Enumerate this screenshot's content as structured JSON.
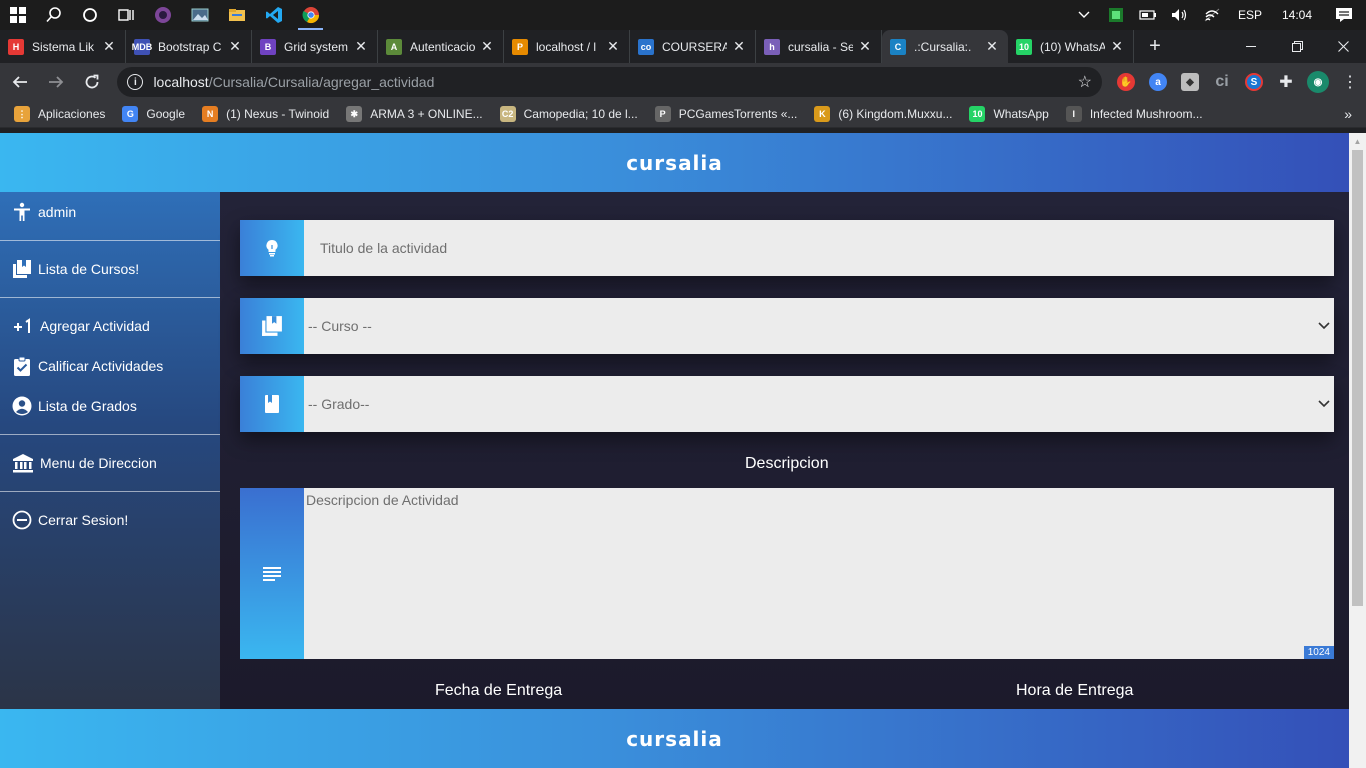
{
  "taskbar": {
    "language": "ESP",
    "time": "14:04",
    "apps": [
      "windows-start",
      "search",
      "cortana",
      "task-view",
      "tor-browser",
      "photos",
      "file-explorer",
      "vscode",
      "chrome"
    ]
  },
  "tabs": [
    {
      "title": "Sistema Lik",
      "color": "#e53935",
      "glyph": "H"
    },
    {
      "title": "Bootstrap C",
      "color": "#3f51b5",
      "glyph": "MDB"
    },
    {
      "title": "Grid system",
      "color": "#6f42c1",
      "glyph": "B"
    },
    {
      "title": "Autenticacio",
      "color": "#5c8a3a",
      "glyph": "A"
    },
    {
      "title": "localhost / l",
      "color": "#e68a00",
      "glyph": "P"
    },
    {
      "title": "COURSERA",
      "color": "#2a73cc",
      "glyph": "co"
    },
    {
      "title": "cursalia - Se",
      "color": "#7a5fb8",
      "glyph": "h"
    },
    {
      "title": ".:Cursalia:.",
      "color": "#1a82c4",
      "glyph": "C"
    },
    {
      "title": "(10) WhatsA",
      "color": "#25d366",
      "glyph": "10"
    }
  ],
  "address": {
    "host": "localhost",
    "path": "/Cursalia/Cursalia/agregar_actividad"
  },
  "bookmarks": [
    {
      "label": "Aplicaciones",
      "color": "#e8a33b",
      "glyph": "⋮"
    },
    {
      "label": "Google",
      "color": "#4285f4",
      "glyph": "G"
    },
    {
      "label": "(1) Nexus - Twinoid",
      "color": "#e67e22",
      "glyph": "N"
    },
    {
      "label": "ARMA 3 + ONLINE...",
      "color": "#777777",
      "glyph": "✱"
    },
    {
      "label": "Camopedia; 10 de l...",
      "color": "#c8b680",
      "glyph": "C2"
    },
    {
      "label": "PCGamesTorrents «...",
      "color": "#666666",
      "glyph": "P"
    },
    {
      "label": "(6) Kingdom.Muxxu...",
      "color": "#d99a1b",
      "glyph": "K"
    },
    {
      "label": "WhatsApp",
      "color": "#25d366",
      "glyph": "10"
    },
    {
      "label": "Infected Mushroom...",
      "color": "#555555",
      "glyph": "I"
    }
  ],
  "site": {
    "logo": "cursalia"
  },
  "sidebar": {
    "user": "admin",
    "courses": "Lista de Cursos!",
    "add_activity": "Agregar Actividad",
    "grade_activities": "Calificar Actividades",
    "grades_list": "Lista de Grados",
    "direction_menu": "Menu de Direccion",
    "logout": "Cerrar Sesion!"
  },
  "form": {
    "title_placeholder": "Titulo de la actividad",
    "course_select": "-- Curso --",
    "grade_select": "-- Grado--",
    "description_label": "Descripcion",
    "description_placeholder": "Descripcion de Actividad",
    "char_counter": "1024",
    "due_date_label": "Fecha de Entrega",
    "due_time_label": "Hora de Entrega"
  },
  "colors": {
    "accent_light": "#3ab7f0",
    "accent_dark": "#3450b8",
    "page_bg": "#1f1d2e"
  }
}
